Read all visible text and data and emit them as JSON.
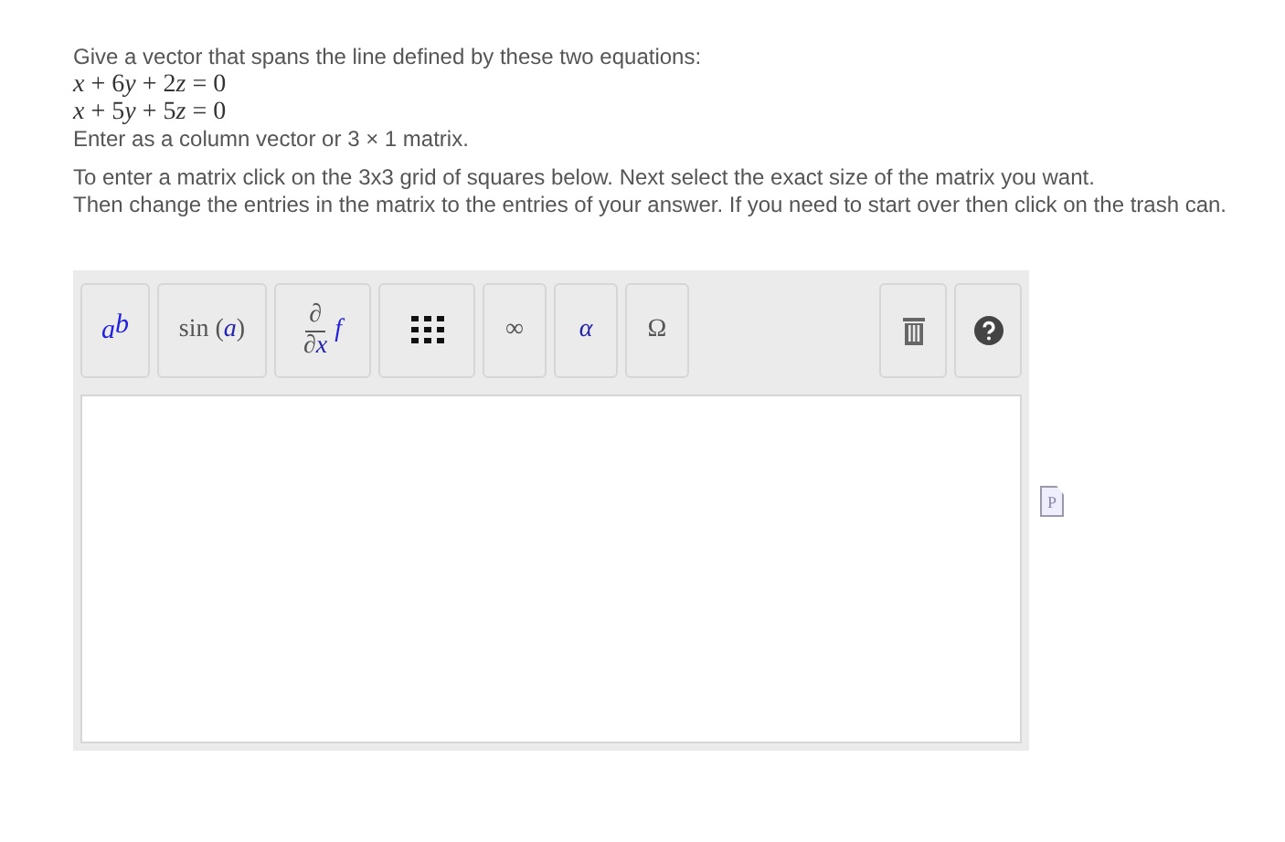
{
  "question": {
    "prompt": "Give a vector that spans the line defined by these two equations:",
    "equations": [
      "x + 6y + 2z = 0",
      "x + 5y + 5z = 0"
    ],
    "format_note": "Enter as a column vector or 3 × 1 matrix."
  },
  "instructions": [
    "To enter a matrix click on the 3x3 grid of squares below. Next select the exact size of the matrix you want.",
    "Then change the entries in the matrix to the entries of your answer. If you need to start over then click on the trash can."
  ],
  "editor": {
    "toolbar": [
      {
        "kind": "power",
        "base": "a",
        "exponent": "b"
      },
      {
        "kind": "text",
        "label": "sin (*a*)"
      },
      {
        "kind": "fraction",
        "numerator": "∂",
        "denominator": "∂*x*",
        "after": "f"
      },
      {
        "kind": "grid"
      },
      {
        "kind": "text",
        "label": "∞"
      },
      {
        "kind": "text",
        "label": "*α*"
      },
      {
        "kind": "text",
        "label": "Ω"
      }
    ],
    "tools": [
      {
        "kind": "trash"
      },
      {
        "kind": "help"
      }
    ]
  },
  "side_icon": {
    "letter": "P"
  }
}
